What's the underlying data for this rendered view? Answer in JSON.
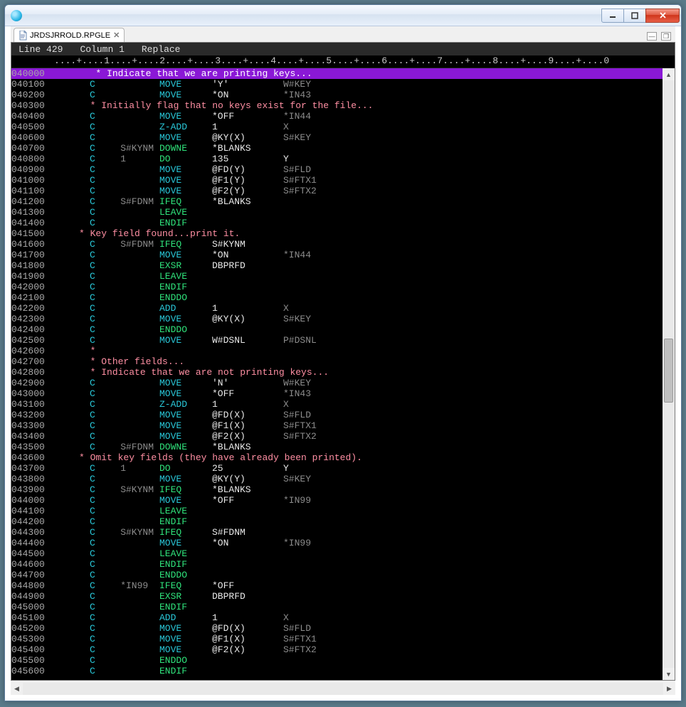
{
  "tab": {
    "filename": "JRDSJRROLD.RPGLE"
  },
  "status": {
    "line_label": "Line",
    "line": "429",
    "col_label": "Column",
    "col": "1",
    "mode": "Replace"
  },
  "ruler": "....+....1....+....2....+....3....+....4....+....5....+....6....+....7....+....8....+....9....+....0",
  "lines": [
    {
      "seq": "040000",
      "type": "cmt",
      "hl": true,
      "cmt": "      * Indicate that we are printing keys..."
    },
    {
      "seq": "040100",
      "type": "c",
      "f1": "",
      "op": "MOVE",
      "f2": "'Y'",
      "res": "W#KEY"
    },
    {
      "seq": "040200",
      "type": "c",
      "f1": "",
      "op": "MOVE",
      "f2": "*ON",
      "res": "*IN43"
    },
    {
      "seq": "040300",
      "type": "cmt",
      "cmt": "     * Initially flag that no keys exist for the file..."
    },
    {
      "seq": "040400",
      "type": "c",
      "f1": "",
      "op": "MOVE",
      "f2": "*OFF",
      "res": "*IN44"
    },
    {
      "seq": "040500",
      "type": "c",
      "f1": "",
      "op": "Z-ADD",
      "f2": "1",
      "res": "X"
    },
    {
      "seq": "040600",
      "type": "c",
      "f1": "",
      "op": "MOVE",
      "f2": "@KY(X)",
      "res": "S#KEY"
    },
    {
      "seq": "040700",
      "type": "c",
      "f1": "S#KYNM",
      "op": "DOWNE",
      "f2": "*BLANKS",
      "res": ""
    },
    {
      "seq": "040800",
      "type": "c",
      "f1": "1",
      "op": "DO",
      "f2": "135",
      "res": "Y"
    },
    {
      "seq": "040900",
      "type": "c",
      "f1": "",
      "op": "MOVE",
      "f2": "@FD(Y)",
      "res": "S#FLD"
    },
    {
      "seq": "041000",
      "type": "c",
      "f1": "",
      "op": "MOVE",
      "f2": "@F1(Y)",
      "res": "S#FTX1"
    },
    {
      "seq": "041100",
      "type": "c",
      "f1": "",
      "op": "MOVE",
      "f2": "@F2(Y)",
      "res": "S#FTX2"
    },
    {
      "seq": "041200",
      "type": "c",
      "f1": "S#FDNM",
      "op": "IFEQ",
      "f2": "*BLANKS",
      "res": ""
    },
    {
      "seq": "041300",
      "type": "c",
      "f1": "",
      "op": "LEAVE",
      "f2": "",
      "res": ""
    },
    {
      "seq": "041400",
      "type": "c",
      "f1": "",
      "op": "ENDIF",
      "f2": "",
      "res": ""
    },
    {
      "seq": "041500",
      "type": "cmt",
      "cmt": "   * Key field found...print it."
    },
    {
      "seq": "041600",
      "type": "c",
      "f1": "S#FDNM",
      "op": "IFEQ",
      "f2": "S#KYNM",
      "res": ""
    },
    {
      "seq": "041700",
      "type": "c",
      "f1": "",
      "op": "MOVE",
      "f2": "*ON",
      "res": "*IN44"
    },
    {
      "seq": "041800",
      "type": "c",
      "f1": "",
      "op": "EXSR",
      "f2": "DBPRFD",
      "res": ""
    },
    {
      "seq": "041900",
      "type": "c",
      "f1": "",
      "op": "LEAVE",
      "f2": "",
      "res": ""
    },
    {
      "seq": "042000",
      "type": "c",
      "f1": "",
      "op": "ENDIF",
      "f2": "",
      "res": ""
    },
    {
      "seq": "042100",
      "type": "c",
      "f1": "",
      "op": "ENDDO",
      "f2": "",
      "res": ""
    },
    {
      "seq": "042200",
      "type": "c",
      "f1": "",
      "op": "ADD",
      "f2": "1",
      "res": "X"
    },
    {
      "seq": "042300",
      "type": "c",
      "f1": "",
      "op": "MOVE",
      "f2": "@KY(X)",
      "res": "S#KEY"
    },
    {
      "seq": "042400",
      "type": "c",
      "f1": "",
      "op": "ENDDO",
      "f2": "",
      "res": ""
    },
    {
      "seq": "042500",
      "type": "c",
      "f1": "",
      "op": "MOVE",
      "f2": "W#DSNL",
      "res": "P#DSNL"
    },
    {
      "seq": "042600",
      "type": "cmt",
      "cmt": "     *"
    },
    {
      "seq": "042700",
      "type": "cmt",
      "cmt": "     * Other fields..."
    },
    {
      "seq": "042800",
      "type": "cmt",
      "cmt": "     * Indicate that we are not printing keys..."
    },
    {
      "seq": "042900",
      "type": "c",
      "f1": "",
      "op": "MOVE",
      "f2": "'N'",
      "res": "W#KEY"
    },
    {
      "seq": "043000",
      "type": "c",
      "f1": "",
      "op": "MOVE",
      "f2": "*OFF",
      "res": "*IN43"
    },
    {
      "seq": "043100",
      "type": "c",
      "f1": "",
      "op": "Z-ADD",
      "f2": "1",
      "res": "X"
    },
    {
      "seq": "043200",
      "type": "c",
      "f1": "",
      "op": "MOVE",
      "f2": "@FD(X)",
      "res": "S#FLD"
    },
    {
      "seq": "043300",
      "type": "c",
      "f1": "",
      "op": "MOVE",
      "f2": "@F1(X)",
      "res": "S#FTX1"
    },
    {
      "seq": "043400",
      "type": "c",
      "f1": "",
      "op": "MOVE",
      "f2": "@F2(X)",
      "res": "S#FTX2"
    },
    {
      "seq": "043500",
      "type": "c",
      "f1": "S#FDNM",
      "op": "DOWNE",
      "f2": "*BLANKS",
      "res": ""
    },
    {
      "seq": "043600",
      "type": "cmt",
      "cmt": "   * Omit key fields (they have already been printed)."
    },
    {
      "seq": "043700",
      "type": "c",
      "f1": "1",
      "op": "DO",
      "f2": "25",
      "res": "Y"
    },
    {
      "seq": "043800",
      "type": "c",
      "f1": "",
      "op": "MOVE",
      "f2": "@KY(Y)",
      "res": "S#KEY"
    },
    {
      "seq": "043900",
      "type": "c",
      "f1": "S#KYNM",
      "op": "IFEQ",
      "f2": "*BLANKS",
      "res": ""
    },
    {
      "seq": "044000",
      "type": "c",
      "f1": "",
      "op": "MOVE",
      "f2": "*OFF",
      "res": "*IN99"
    },
    {
      "seq": "044100",
      "type": "c",
      "f1": "",
      "op": "LEAVE",
      "f2": "",
      "res": ""
    },
    {
      "seq": "044200",
      "type": "c",
      "f1": "",
      "op": "ENDIF",
      "f2": "",
      "res": ""
    },
    {
      "seq": "044300",
      "type": "c",
      "f1": "S#KYNM",
      "op": "IFEQ",
      "f2": "S#FDNM",
      "res": ""
    },
    {
      "seq": "044400",
      "type": "c",
      "f1": "",
      "op": "MOVE",
      "f2": "*ON",
      "res": "*IN99"
    },
    {
      "seq": "044500",
      "type": "c",
      "f1": "",
      "op": "LEAVE",
      "f2": "",
      "res": ""
    },
    {
      "seq": "044600",
      "type": "c",
      "f1": "",
      "op": "ENDIF",
      "f2": "",
      "res": ""
    },
    {
      "seq": "044700",
      "type": "c",
      "f1": "",
      "op": "ENDDO",
      "f2": "",
      "res": ""
    },
    {
      "seq": "044800",
      "type": "c",
      "f1": "*IN99",
      "op": "IFEQ",
      "f2": "*OFF",
      "res": ""
    },
    {
      "seq": "044900",
      "type": "c",
      "f1": "",
      "op": "EXSR",
      "f2": "DBPRFD",
      "res": ""
    },
    {
      "seq": "045000",
      "type": "c",
      "f1": "",
      "op": "ENDIF",
      "f2": "",
      "res": ""
    },
    {
      "seq": "045100",
      "type": "c",
      "f1": "",
      "op": "ADD",
      "f2": "1",
      "res": "X"
    },
    {
      "seq": "045200",
      "type": "c",
      "f1": "",
      "op": "MOVE",
      "f2": "@FD(X)",
      "res": "S#FLD"
    },
    {
      "seq": "045300",
      "type": "c",
      "f1": "",
      "op": "MOVE",
      "f2": "@F1(X)",
      "res": "S#FTX1"
    },
    {
      "seq": "045400",
      "type": "c",
      "f1": "",
      "op": "MOVE",
      "f2": "@F2(X)",
      "res": "S#FTX2"
    },
    {
      "seq": "045500",
      "type": "c",
      "f1": "",
      "op": "ENDDO",
      "f2": "",
      "res": ""
    },
    {
      "seq": "045600",
      "type": "c",
      "f1": "",
      "op": "ENDIF",
      "f2": "",
      "res": ""
    }
  ]
}
